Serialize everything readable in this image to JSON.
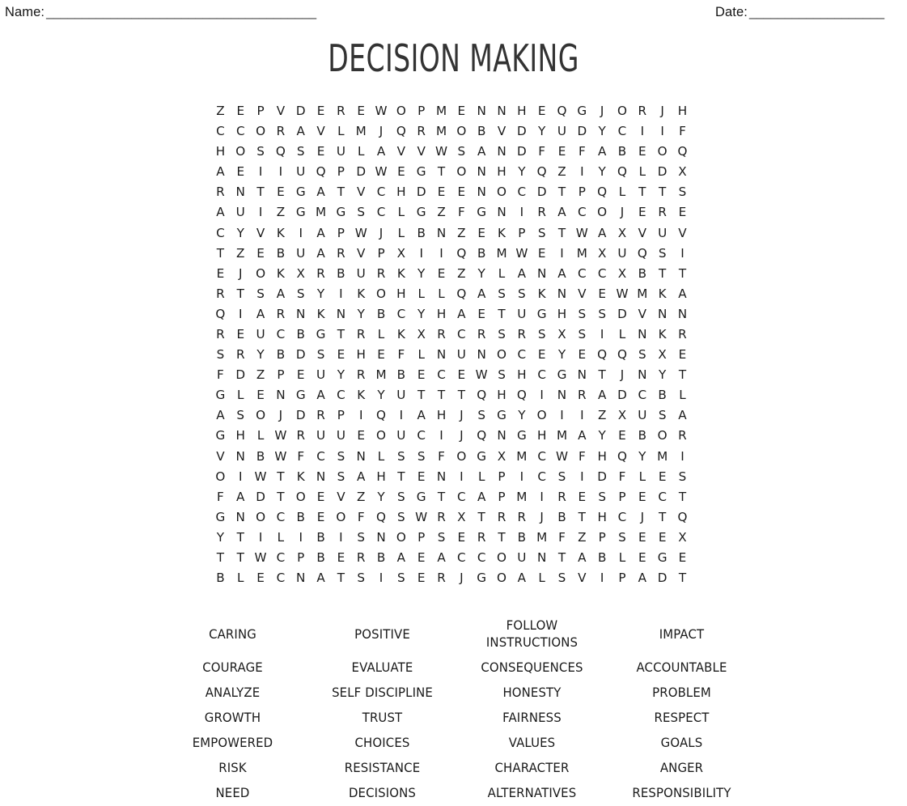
{
  "header": {
    "name_label": "Name:",
    "name_rule": "______________________________________",
    "date_label": "Date:",
    "date_rule": "___________________"
  },
  "title": "DECISION MAKING",
  "grid": {
    "rows": 24,
    "cols": 24,
    "letters": [
      "Z E P V D E R E W O P M E N N H E Q G J O R J H",
      "C C O R A V L M J Q R M O B V D Y U D Y C I I F",
      "H O S Q S E U L A V V W S A N D F E F A B E O Q",
      "A E I I U Q P D W E G T O N H Y Q Z I Y Q L D X",
      "R N T E G A T V C H D E E N O C D T P Q L T T S",
      "A U I Z G M G S C L G Z F G N I R A C O J E R E",
      "C Y V K I A P W J L B N Z E K P S T W A X V U V",
      "T Z E B U A R V P X I I Q B M W E I M X U Q S I",
      "E J O K X R B U R K Y E Z Y L A N A C C X B T T",
      "R T S A S Y I K O H L L Q A S S K N V E W M K A",
      "Q I A R N K N Y B C Y H A E T U G H S S D V N N",
      "R E U C B G T R L K X R C R S R S X S I L N K R",
      "S R Y B D S E H E F L N U N O C E Y E Q Q S X E",
      "F D Z P E U Y R M B E C E W S H C G N T J N Y T",
      "G L E N G A C K Y U T T T Q H Q I N R A D C B L",
      "A S O J D R P I Q I A H J S G Y O I I Z X U S A",
      "G H L W R U U E O U C I J Q N G H M A Y E B O R",
      "V N B W F C S N L S S F O G X M C W F H Q Y M I",
      "O I W T K N S A H T E N I L P I C S I D F L E S",
      "F A D T O E V Z Y S G T C A P M I R E S P E C T",
      "G N O C B E O F Q S W R X T R R J B T H C J T Q",
      "Y T I L I B I S N O P S E R T B M F Z P S E E X",
      "T T W C P B E R B A E A C C O U N T A B L E G E",
      "B L E C N A T S I S E R J G O A L S V I P A D T"
    ]
  },
  "word_list": {
    "columns": 4,
    "rows": [
      [
        "CARING",
        "POSITIVE",
        "FOLLOW\nINSTRUCTIONS",
        "IMPACT"
      ],
      [
        "COURAGE",
        "EVALUATE",
        "CONSEQUENCES",
        "ACCOUNTABLE"
      ],
      [
        "ANALYZE",
        "SELF DISCIPLINE",
        "HONESTY",
        "PROBLEM"
      ],
      [
        "GROWTH",
        "TRUST",
        "FAIRNESS",
        "RESPECT"
      ],
      [
        "EMPOWERED",
        "CHOICES",
        "VALUES",
        "GOALS"
      ],
      [
        "RISK",
        "RESISTANCE",
        "CHARACTER",
        "ANGER"
      ],
      [
        "NEED",
        "DECISIONS",
        "ALTERNATIVES",
        "RESPONSIBILITY"
      ]
    ]
  },
  "colors": {
    "page_background": "#ffffff",
    "text": "#1b1b1b",
    "title": "#333333",
    "rule": "#3b3b3b"
  }
}
